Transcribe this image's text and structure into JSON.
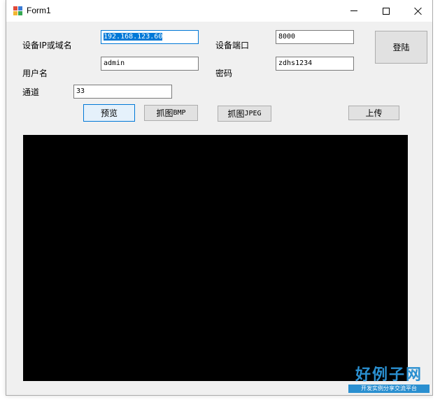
{
  "window": {
    "title": "Form1"
  },
  "form": {
    "ip_label": "设备IP或域名",
    "ip_value": "192.168.123.60",
    "port_label": "设备端口",
    "port_value": "8000",
    "user_label": "用户名",
    "user_value": "admin",
    "password_label": "密码",
    "password_value": "zdhs1234",
    "channel_label": "通道",
    "channel_value": "33"
  },
  "buttons": {
    "login": "登陆",
    "preview": "预览",
    "capture_bmp_prefix": "抓图",
    "capture_bmp_suffix": "BMP",
    "capture_jpeg_prefix": "抓图",
    "capture_jpeg_suffix": "JPEG",
    "upload": "上传"
  },
  "watermark": {
    "main": "好例子网",
    "sub": "开发实例分享交流平台"
  },
  "colors": {
    "accent": "#0078d7",
    "video_bg": "#000000",
    "watermark": "#2a8fd0"
  }
}
